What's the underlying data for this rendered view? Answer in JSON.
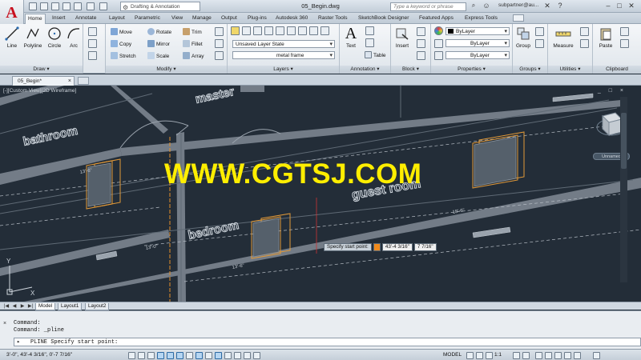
{
  "titlebar": {
    "app_letter": "A",
    "workspace": "Drafting & Annotation",
    "document": "05_Begin.dwg",
    "search_placeholder": "Type a keyword or phrase",
    "user": "subpartner@au..."
  },
  "tabs": [
    "Home",
    "Insert",
    "Annotate",
    "Layout",
    "Parametric",
    "View",
    "Manage",
    "Output",
    "Plug-ins",
    "Autodesk 360",
    "Raster Tools",
    "SketchBook Designer",
    "Featured Apps",
    "Express Tools"
  ],
  "ribbon": {
    "draw": {
      "title": "Draw",
      "line": "Line",
      "polyline": "Polyline",
      "circle": "Circle",
      "arc": "Arc"
    },
    "modify": {
      "title": "Modify",
      "move": "Move",
      "rotate": "Rotate",
      "trim": "Trim",
      "copy": "Copy",
      "mirror": "Mirror",
      "fillet": "Fillet",
      "stretch": "Stretch",
      "scale": "Scale",
      "array": "Array"
    },
    "layers": {
      "title": "Layers",
      "layer_state": "Unsaved Layer State",
      "current_layer": "metal frame"
    },
    "annotation": {
      "title": "Annotation",
      "text": "Text",
      "table": "Table"
    },
    "block": {
      "title": "Block",
      "insert": "Insert"
    },
    "properties": {
      "title": "Properties",
      "color": "ByLayer",
      "linetype": "ByLayer",
      "lineweight": "ByLayer"
    },
    "groups": {
      "title": "Groups",
      "group": "Group"
    },
    "utilities": {
      "title": "Utilities",
      "measure": "Measure"
    },
    "clipboard": {
      "title": "Clipboard",
      "paste": "Paste"
    }
  },
  "file_tab": "05_Begin*",
  "viewport": {
    "label": "[-][Custom View][2D Wireframe]",
    "controls": "_ □ ×",
    "watermark": "WWW.CGTSJ.COM",
    "rooms": {
      "master": "master",
      "bathroom": "bathroom",
      "guest_room": "guest room",
      "bedroom": "bedroom"
    },
    "dims": {
      "d1": "13'-0\"",
      "d2": "13'-6\"",
      "d3": "13'-6\"",
      "d4": "18'-6\""
    },
    "ucs_y": "Y",
    "ucs_x": "X",
    "nav_label": "Unnamed",
    "tooltip": {
      "prompt": "Specify start point:",
      "value1": "43'-4 3/16\"",
      "value2": "7 7/16\""
    }
  },
  "layout_tabs": [
    "Model",
    "Layout1",
    "Layout2"
  ],
  "command": {
    "history": [
      "Command:",
      "Command: _pline"
    ],
    "current": "PLINE Specify start point:"
  },
  "status": {
    "coords": "3'-0\",    43'-4 3/16\", 0'-7 7/16\"",
    "model": "MODEL",
    "scale": "1:1"
  },
  "colors": {
    "accent": "#c8101e",
    "watermark": "#ffee00",
    "tooltip_icon": "#f08a1c",
    "viewport": "#232d38"
  }
}
